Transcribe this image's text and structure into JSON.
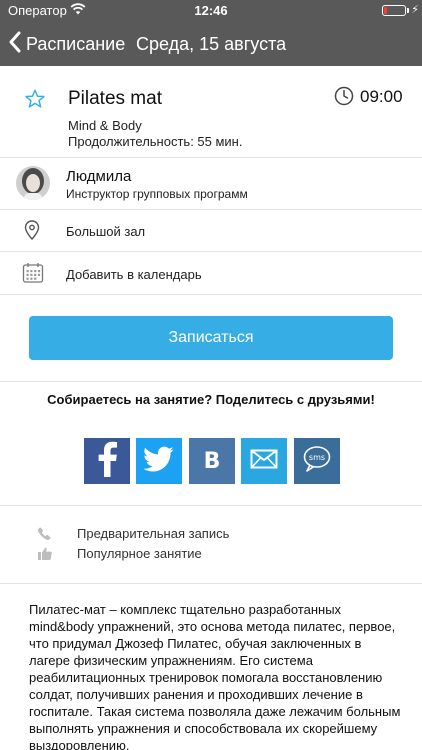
{
  "status_bar": {
    "carrier": "Оператор",
    "time": "12:46"
  },
  "nav": {
    "back_label": "Расписание",
    "title": "Среда, 15 августа"
  },
  "class": {
    "title": "Pilates mat",
    "subtitle": "Mind & Body",
    "duration": "Продолжительность: 55 мин.",
    "time": "09:00"
  },
  "instructor": {
    "name": "Людмила",
    "role": "Инструктор групповых программ"
  },
  "location": {
    "label": "Большой зал"
  },
  "calendar": {
    "label": "Добавить в календарь"
  },
  "signup": {
    "label": "Записаться"
  },
  "share": {
    "prompt": "Собираетесь на занятие? Поделитесь с друзьями!",
    "networks": [
      "facebook",
      "twitter",
      "vk",
      "email",
      "sms"
    ],
    "vk_letter": "В",
    "sms_text": "sms"
  },
  "features": [
    {
      "icon": "phone-icon",
      "label": "Предварительная запись"
    },
    {
      "icon": "thumbs-up-icon",
      "label": "Популярное занятие"
    }
  ],
  "description": "Пилатес-мат – комплекс тщательно разработанных mind&body упражнений, это основа метода пилатес, первое, что придумал Джозеф Пилатес, обучая заключенных в лагере физическим упражнениям. Его система реабилитационных тренировок помогала восстановлению солдат, получивших ранения и проходивших лечение в госпитале. Такая система позволяла даже лежачим больным выполнять упражнения и способствовала их скорейшему выздоровлению.",
  "colors": {
    "nav_background": "#595959",
    "accent": "#36aee5",
    "facebook": "#3b5998",
    "twitter": "#1da1f2",
    "vk": "#4a76a8",
    "email": "#2aa7e0",
    "sms": "#3a6d9a"
  }
}
